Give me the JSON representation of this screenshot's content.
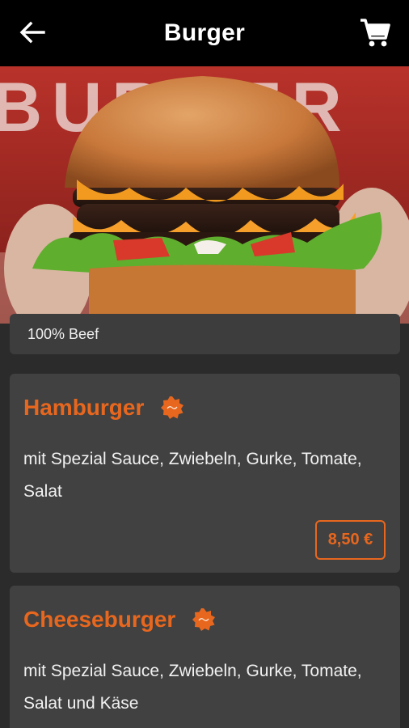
{
  "header": {
    "title": "Burger",
    "back_icon": "arrow-left-icon",
    "cart_icon": "shopping-cart-icon"
  },
  "hero": {
    "image": "burger-photo",
    "background_text": "BURGER"
  },
  "category": {
    "label": "100% Beef"
  },
  "products": [
    {
      "name": "Hamburger",
      "badge_icon": "halal-badge-icon",
      "description": "mit Spezial Sauce, Zwiebeln, Gurke, Tomate, Salat",
      "price": "8,50 €"
    },
    {
      "name": "Cheeseburger",
      "badge_icon": "halal-badge-icon",
      "description": "mit Spezial Sauce, Zwiebeln, Gurke, Tomate, Salat und Käse"
    }
  ],
  "colors": {
    "accent": "#e8671e",
    "background": "#2b2b2b",
    "card": "#414141",
    "appbar": "#000000"
  }
}
